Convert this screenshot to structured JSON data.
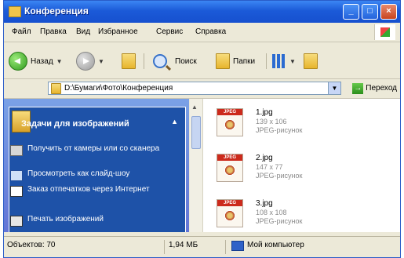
{
  "window": {
    "title": "Конференция"
  },
  "menu": [
    "Файл",
    "Правка",
    "Вид",
    "Избранное",
    "Сервис",
    "Справка"
  ],
  "toolbar": {
    "back_label": "Назад",
    "search_label": "Поиск",
    "folders_label": "Папки"
  },
  "address": {
    "path": "D:\\Бумаги\\Фото\\Конференция",
    "go_label": "Переход"
  },
  "tasks": {
    "title": "Задачи для изображений",
    "items": [
      {
        "label": "Получить от камеры или со сканера"
      },
      {
        "label": "Просмотреть как слайд-шоу"
      },
      {
        "label": "Заказ отпечатков через Интернет"
      },
      {
        "label": "Печать изображений"
      }
    ]
  },
  "files": [
    {
      "name": "1.jpg",
      "dims": "139 x 106",
      "type": "JPEG-рисунок"
    },
    {
      "name": "2.jpg",
      "dims": "147 x 77",
      "type": "JPEG-рисунок"
    },
    {
      "name": "3.jpg",
      "dims": "108 x 108",
      "type": "JPEG-рисунок"
    }
  ],
  "status": {
    "objects": "Объектов: 70",
    "size": "1,94 МБ",
    "location": "Мой компьютер"
  }
}
